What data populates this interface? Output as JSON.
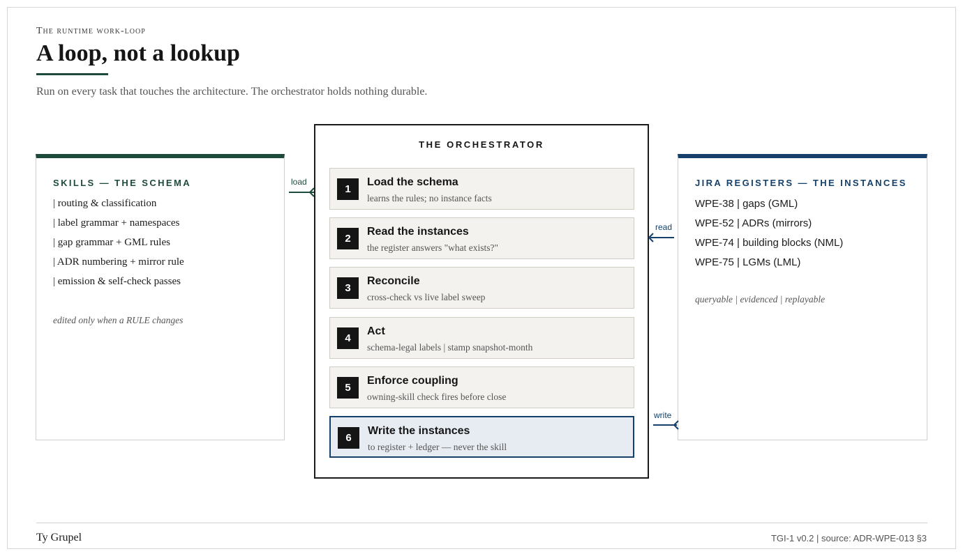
{
  "header": {
    "eyebrow": "The runtime work-loop",
    "title": "A loop, not a lookup",
    "subtitle": "Run on every task that touches the architecture. The orchestrator holds nothing durable."
  },
  "skills_panel": {
    "heading": "SKILLS — THE SCHEMA",
    "items": [
      "| routing & classification",
      "| label grammar + namespaces",
      "| gap grammar + GML rules",
      "| ADR numbering + mirror rule",
      "| emission & self-check passes"
    ],
    "note": "edited only when a RULE changes"
  },
  "orchestrator": {
    "heading": "THE ORCHESTRATOR",
    "steps": [
      {
        "num": "1",
        "title": "Load the schema",
        "subtitle": "learns the rules; no instance facts"
      },
      {
        "num": "2",
        "title": "Read the instances",
        "subtitle": "the register answers \"what exists?\""
      },
      {
        "num": "3",
        "title": "Reconcile",
        "subtitle": "cross-check vs live label sweep"
      },
      {
        "num": "4",
        "title": "Act",
        "subtitle": "schema-legal labels | stamp snapshot-month"
      },
      {
        "num": "5",
        "title": "Enforce coupling",
        "subtitle": "owning-skill check fires before close"
      },
      {
        "num": "6",
        "title": "Write the instances",
        "subtitle": "to register + ledger — never the skill"
      }
    ]
  },
  "registers_panel": {
    "heading": "JIRA REGISTERS — THE INSTANCES",
    "items": [
      "WPE-38 | gaps (GML)",
      "WPE-52 | ADRs (mirrors)",
      "WPE-74 | building blocks (NML)",
      "WPE-75 | LGMs (LML)"
    ],
    "note": "queryable | evidenced | replayable"
  },
  "connectors": {
    "load": "load",
    "read": "read",
    "write": "write"
  },
  "colors": {
    "schema_green": "#1e4a3c",
    "register_blue": "#14406a",
    "step_bg": "#f3f2ee",
    "active_step_bg": "#e7ecf3"
  },
  "footer": {
    "author": "Ty Grupel",
    "source": "TGI-1 v0.2 | source: ADR-WPE-013 §3"
  }
}
